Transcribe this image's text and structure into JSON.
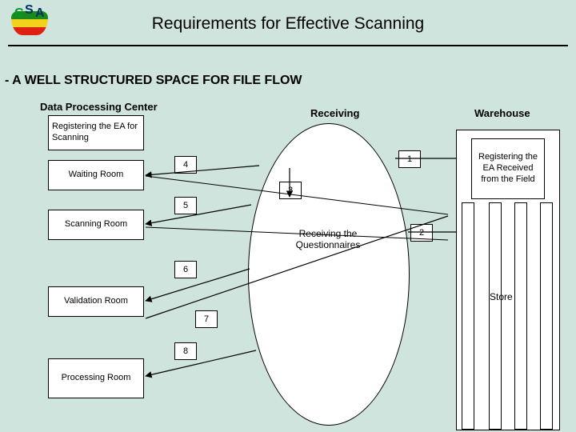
{
  "title": "Requirements for Effective Scanning",
  "subtitle": "- A WELL STRUCTURED SPACE FOR FILE FLOW",
  "sections": {
    "data_processing_center": "Data Processing Center",
    "receiving": "Receiving",
    "warehouse": "Warehouse"
  },
  "left_rooms": {
    "registering": "Registering the EA for Scanning",
    "waiting": "Waiting Room",
    "scanning": "Scanning Room",
    "validation": "Validation Room",
    "processing": "Processing Room"
  },
  "oval_caption": "Receiving the Questionnaires",
  "warehouse_box": "Registering the EA Received from the Field",
  "store_label": "Store",
  "flow_tags": {
    "t1": "1",
    "t2": "2",
    "t3": "3",
    "t4": "4",
    "t5": "5",
    "t6": "6",
    "t7": "7",
    "t8": "8"
  }
}
